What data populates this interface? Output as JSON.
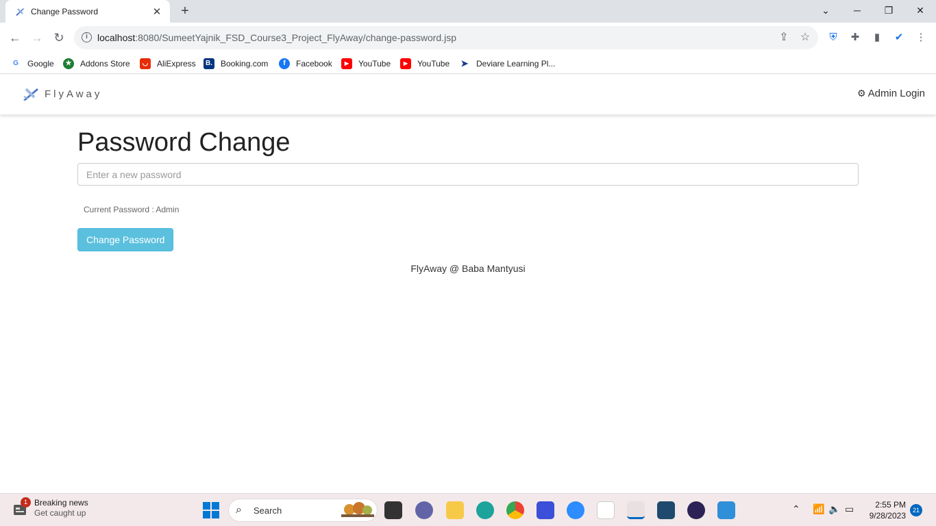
{
  "browser": {
    "tab_title": "Change Password",
    "url_host": "localhost",
    "url_rest": ":8080/SumeetYajnik_FSD_Course3_Project_FlyAway/change-password.jsp",
    "bookmarks": [
      {
        "label": "Google",
        "icon": "google-icon",
        "color": "#4285f4"
      },
      {
        "label": "Addons Store",
        "icon": "addons-store-icon",
        "color": "#1e7e34"
      },
      {
        "label": "AliExpress",
        "icon": "aliexpress-icon",
        "color": "#e62e04"
      },
      {
        "label": "Booking.com",
        "icon": "booking-icon",
        "color": "#003580"
      },
      {
        "label": "Facebook",
        "icon": "facebook-icon",
        "color": "#1877f2"
      },
      {
        "label": "YouTube",
        "icon": "youtube-icon",
        "color": "#ff0000"
      },
      {
        "label": "YouTube",
        "icon": "youtube-icon",
        "color": "#ff0000"
      },
      {
        "label": "Deviare Learning Pl...",
        "icon": "deviare-icon",
        "color": "#1a3a8a"
      }
    ]
  },
  "navbar": {
    "brand": "FlyAway",
    "admin_login": "Admin Login"
  },
  "main": {
    "heading": "Password Change",
    "input_placeholder": "Enter a new password",
    "current_password": "Current Password : Admin",
    "button_label": "Change Password",
    "button_color": "#5bc0de"
  },
  "footer": {
    "text": "FlyAway @ Baba Mantyusi"
  },
  "taskbar": {
    "news_title": "Breaking news",
    "news_subtitle": "Get caught up",
    "news_badge": "1",
    "search_label": "Search",
    "time": "2:55 PM",
    "date": "9/28/2023",
    "notifications": "21"
  }
}
